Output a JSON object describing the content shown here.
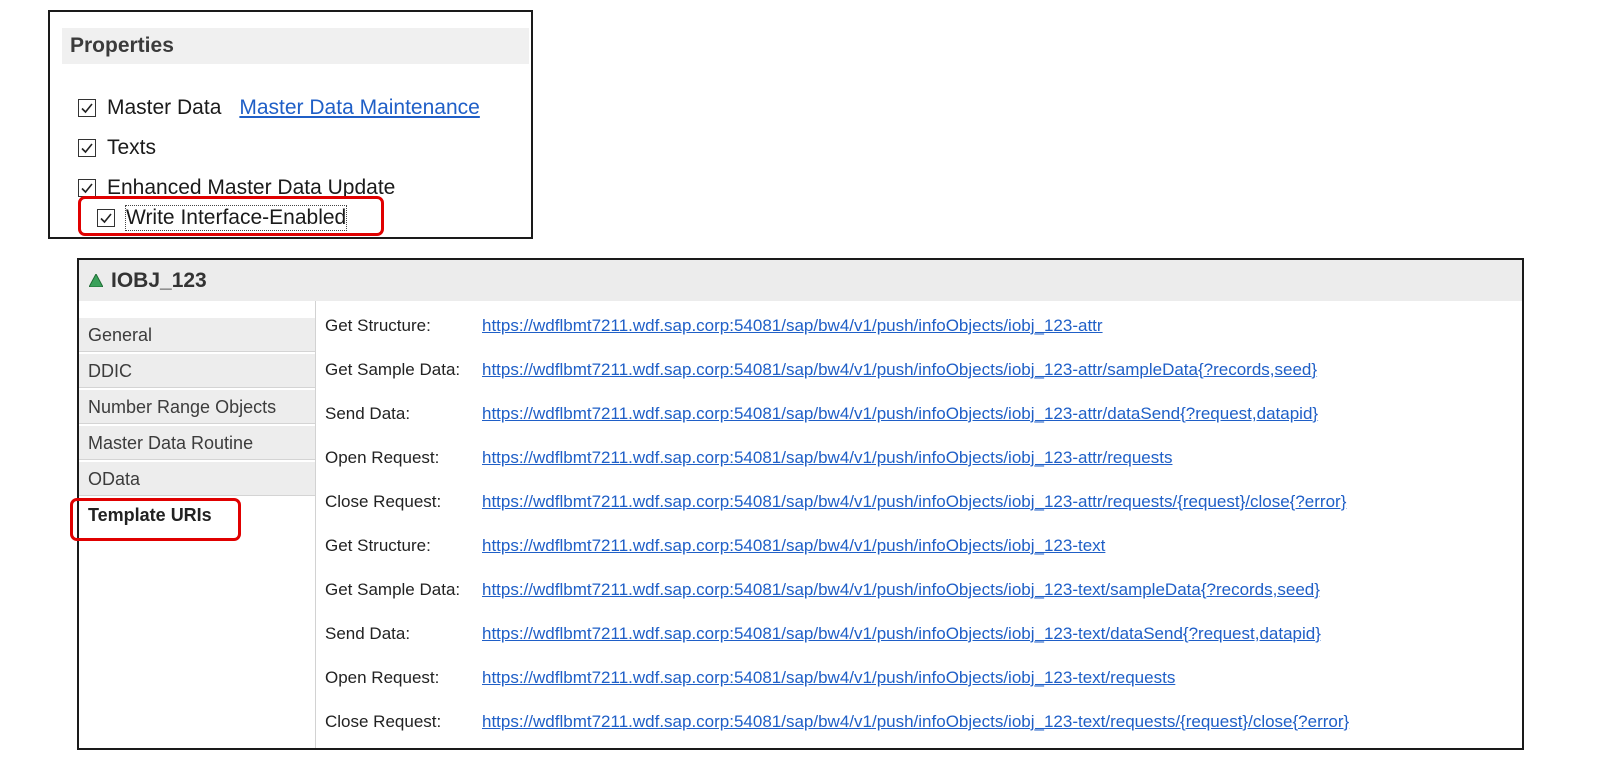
{
  "properties": {
    "title": "Properties",
    "items": [
      {
        "label": "Master Data",
        "checked": true,
        "link": "Master Data Maintenance"
      },
      {
        "label": "Texts",
        "checked": true
      },
      {
        "label": "Enhanced Master Data Update",
        "checked": true
      },
      {
        "label": "Write Interface-Enabled",
        "checked": true
      }
    ]
  },
  "editor": {
    "title": "IOBJ_123",
    "tabs": [
      {
        "label": "General"
      },
      {
        "label": "DDIC"
      },
      {
        "label": "Number Range Objects"
      },
      {
        "label": "Master Data Routine"
      },
      {
        "label": "OData"
      },
      {
        "label": "Template URIs",
        "active": true
      }
    ],
    "uris": [
      {
        "label": "Get Structure:",
        "url": "https://wdflbmt7211.wdf.sap.corp:54081/sap/bw4/v1/push/infoObjects/iobj_123-attr"
      },
      {
        "label": "Get Sample Data:",
        "url": "https://wdflbmt7211.wdf.sap.corp:54081/sap/bw4/v1/push/infoObjects/iobj_123-attr/sampleData{?records,seed}"
      },
      {
        "label": "Send Data:",
        "url": "https://wdflbmt7211.wdf.sap.corp:54081/sap/bw4/v1/push/infoObjects/iobj_123-attr/dataSend{?request,datapid}"
      },
      {
        "label": "Open Request:",
        "url": "https://wdflbmt7211.wdf.sap.corp:54081/sap/bw4/v1/push/infoObjects/iobj_123-attr/requests"
      },
      {
        "label": "Close Request:",
        "url": "https://wdflbmt7211.wdf.sap.corp:54081/sap/bw4/v1/push/infoObjects/iobj_123-attr/requests/{request}/close{?error}"
      },
      {
        "label": "Get Structure:",
        "url": "https://wdflbmt7211.wdf.sap.corp:54081/sap/bw4/v1/push/infoObjects/iobj_123-text"
      },
      {
        "label": "Get Sample Data:",
        "url": "https://wdflbmt7211.wdf.sap.corp:54081/sap/bw4/v1/push/infoObjects/iobj_123-text/sampleData{?records,seed}"
      },
      {
        "label": "Send Data:",
        "url": "https://wdflbmt7211.wdf.sap.corp:54081/sap/bw4/v1/push/infoObjects/iobj_123-text/dataSend{?request,datapid}"
      },
      {
        "label": "Open Request:",
        "url": "https://wdflbmt7211.wdf.sap.corp:54081/sap/bw4/v1/push/infoObjects/iobj_123-text/requests"
      },
      {
        "label": "Close Request:",
        "url": "https://wdflbmt7211.wdf.sap.corp:54081/sap/bw4/v1/push/infoObjects/iobj_123-text/requests/{request}/close{?error}"
      }
    ]
  },
  "colors": {
    "link": "#1f5fc7",
    "highlight": "#e00000",
    "object-icon": "#3aa15a"
  },
  "icons": {
    "object": "green-triangle-icon",
    "checkbox": "checkmark-icon"
  }
}
